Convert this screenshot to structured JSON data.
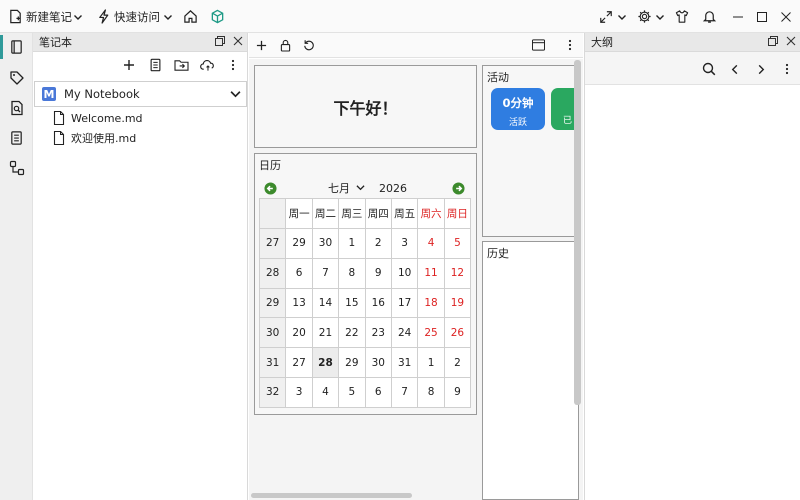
{
  "topbar": {
    "new_note": "新建笔记",
    "quick_access": "快速访问"
  },
  "notebook_panel": {
    "title": "笔记本",
    "selected_notebook": "My Notebook",
    "notebook_letter": "M",
    "files": [
      "Welcome.md",
      "欢迎使用.md"
    ]
  },
  "dashboard": {
    "greeting": "下午好！",
    "calendar": {
      "title": "日历",
      "month": "七月",
      "year": "2026",
      "weekdays": [
        "周一",
        "周二",
        "周三",
        "周四",
        "周五",
        "周六",
        "周日"
      ],
      "rows": [
        {
          "week": "27",
          "days": [
            "29",
            "30",
            "1",
            "2",
            "3",
            "4",
            "5"
          ]
        },
        {
          "week": "28",
          "days": [
            "6",
            "7",
            "8",
            "9",
            "10",
            "11",
            "12"
          ]
        },
        {
          "week": "29",
          "days": [
            "13",
            "14",
            "15",
            "16",
            "17",
            "18",
            "19"
          ]
        },
        {
          "week": "30",
          "days": [
            "20",
            "21",
            "22",
            "23",
            "24",
            "25",
            "26"
          ]
        },
        {
          "week": "31",
          "days": [
            "27",
            "28",
            "29",
            "30",
            "31",
            "1",
            "2"
          ]
        },
        {
          "week": "32",
          "days": [
            "3",
            "4",
            "5",
            "6",
            "7",
            "8",
            "9"
          ]
        }
      ]
    },
    "activity": {
      "title": "活动",
      "cards": [
        {
          "value": "0分钟",
          "label": "活跃",
          "color": "#2f7de1"
        },
        {
          "value": "",
          "label": "已",
          "color": "#2aa860"
        }
      ]
    },
    "history": {
      "title": "历史"
    }
  },
  "outline_panel": {
    "title": "大纲"
  },
  "colors": {
    "accent": "#2f9a9a",
    "weekend": "#dd2222",
    "activity_blue": "#2f7de1",
    "activity_green": "#2aa860"
  }
}
